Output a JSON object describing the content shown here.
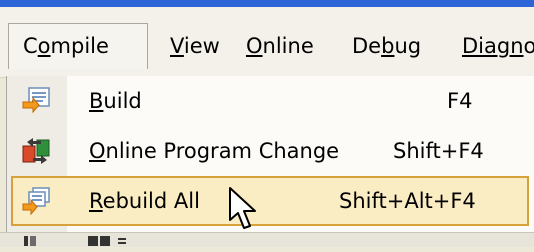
{
  "menubar": {
    "items": [
      {
        "label_pre": "C",
        "label_u": "o",
        "label_post": "mpile",
        "active": true
      },
      {
        "label_pre": "",
        "label_u": "V",
        "label_post": "iew"
      },
      {
        "label_pre": "",
        "label_u": "O",
        "label_post": "nline"
      },
      {
        "label_pre": "De",
        "label_u": "b",
        "label_post": "ug"
      },
      {
        "label_pre": "Diagn",
        "label_u": "",
        "label_post": "o"
      }
    ]
  },
  "dropdown": {
    "items": [
      {
        "label_pre": "",
        "label_u": "B",
        "label_post": "uild",
        "shortcut": "F4",
        "icon": "build-icon"
      },
      {
        "label_pre": "",
        "label_u": "O",
        "label_post": "nline Program Change",
        "shortcut": "Shift+F4",
        "icon": "online-change-icon"
      },
      {
        "label_pre": "",
        "label_u": "R",
        "label_post": "ebuild All",
        "shortcut": "Shift+Alt+F4",
        "icon": "rebuild-icon",
        "highlighted": true
      }
    ]
  },
  "colors": {
    "titlebar": "#2d64d8",
    "highlight_bg": "#fbedc3",
    "highlight_border": "#d7a23c"
  }
}
